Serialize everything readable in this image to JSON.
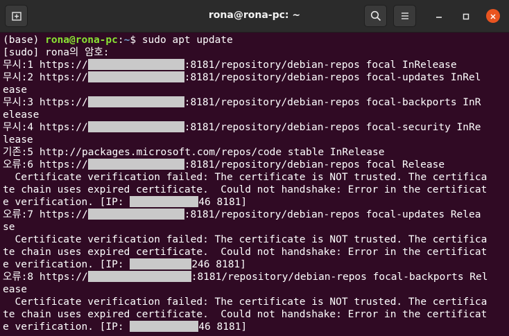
{
  "window": {
    "title": "rona@rona-pc: ~",
    "new_tab_icon": "new-tab-icon",
    "search_icon": "search-icon",
    "menu_icon": "hamburger-menu-icon",
    "minimize_icon": "minimize-icon",
    "maximize_icon": "maximize-icon",
    "close_icon": "close-icon",
    "accent": "#e95420"
  },
  "terminal": {
    "background": "#300a24",
    "prompt": {
      "env": "(base) ",
      "user_host": "rona@rona-pc",
      "colon": ":",
      "path": "~",
      "symbol": "$ ",
      "command": "sudo apt update"
    },
    "lines": [
      "[sudo] rona의 암호: ",
      "무시:1 https://",
      ":8181/repository/debian-repos focal InRelease",
      "무시:2 https://",
      ":8181/repository/debian-repos focal-updates InRel",
      "ease",
      "무시:3 https://",
      ":8181/repository/debian-repos focal-backports InR",
      "elease",
      "무시:4 https://",
      ":8181/repository/debian-repos focal-security InRe",
      "lease",
      "기존:5 http://packages.microsoft.com/repos/code stable InRelease",
      "오류:6 https://",
      ":8181/repository/debian-repos focal Release",
      "  Certificate verification failed: The certificate is NOT trusted. The certifica",
      "te chain uses expired certificate.  Could not handshake: Error in the certificat",
      "e verification. [IP: ",
      "46 8181]",
      "오류:7 https://",
      ":8181/repository/debian-repos focal-updates Relea",
      "se",
      "  Certificate verification failed: The certificate is NOT trusted. The certifica",
      "te chain uses expired certificate.  Could not handshake: Error in the certificat",
      "e verification. [IP: ",
      "246 8181]",
      "오류:8 https://",
      ":8181/repository/debian-repos focal-backports Rel",
      "ease",
      "  Certificate verification failed: The certificate is NOT trusted. The certifica",
      "te chain uses expired certificate.  Could not handshake: Error in the certificat",
      "e verification. [IP: ",
      "46 8181]"
    ]
  }
}
